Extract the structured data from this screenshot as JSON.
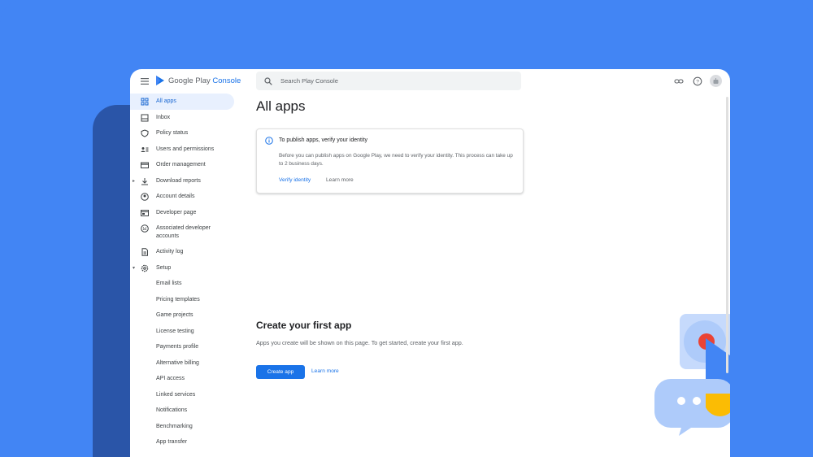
{
  "app": {
    "logo_text": "Google Play",
    "logo_suffix": "Console"
  },
  "search": {
    "placeholder": "Search Play Console"
  },
  "sidebar": {
    "items": [
      {
        "label": "All apps",
        "icon": "grid-icon",
        "active": true
      },
      {
        "label": "Inbox",
        "icon": "inbox-icon"
      },
      {
        "label": "Policy status",
        "icon": "shield-icon"
      },
      {
        "label": "Users and permissions",
        "icon": "people-icon"
      },
      {
        "label": "Order management",
        "icon": "card-icon"
      },
      {
        "label": "Download reports",
        "icon": "download-icon",
        "expandable": true
      },
      {
        "label": "Account details",
        "icon": "account-circle-icon"
      },
      {
        "label": "Developer page",
        "icon": "web-page-icon"
      },
      {
        "label": "Associated developer accounts",
        "icon": "smile-icon"
      },
      {
        "label": "Activity log",
        "icon": "document-icon"
      },
      {
        "label": "Setup",
        "icon": "gear-icon",
        "expanded": true
      },
      {
        "label": "Email lists"
      },
      {
        "label": "Pricing templates"
      },
      {
        "label": "Game projects"
      },
      {
        "label": "License testing"
      },
      {
        "label": "Payments profile"
      },
      {
        "label": "Alternative billing"
      },
      {
        "label": "API access"
      },
      {
        "label": "Linked services"
      },
      {
        "label": "Notifications"
      },
      {
        "label": "Benchmarking"
      },
      {
        "label": "App transfer"
      }
    ]
  },
  "main": {
    "title": "All apps",
    "banner": {
      "title": "To publish apps, verify your identity",
      "body": "Before you can publish apps on Google Play, we need to verify your identity. This process can take up to 2 business days.",
      "primary_link": "Verify identity",
      "secondary_link": "Learn more"
    },
    "empty_state": {
      "title": "Create your first app",
      "body": "Apps you create will be shown on this page. To get started, create your first app.",
      "button": "Create app",
      "link": "Learn more"
    }
  },
  "colors": {
    "background": "#4285f4",
    "accent": "#1a73e8",
    "active_nav_bg": "#e8f0fe"
  }
}
